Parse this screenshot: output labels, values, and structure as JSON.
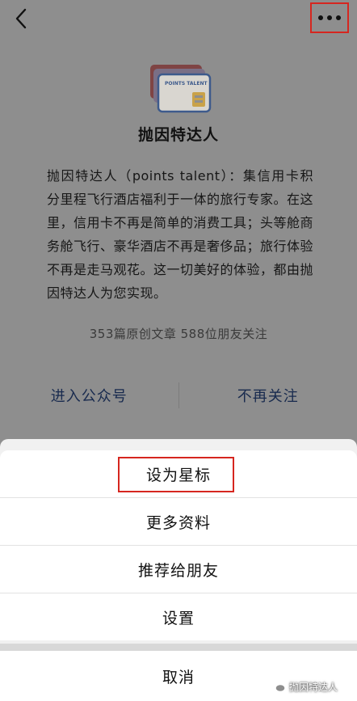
{
  "navbar": {
    "back_icon": "chevron-left-icon",
    "more_icon": "more-dots-icon"
  },
  "account": {
    "logo_text": "POINTS TALENT",
    "name": "抛因特达人",
    "description": "抛因特达人（points talent）：集信用卡积分里程飞行酒店福利于一体的旅行专家。在这里，信用卡不再是简单的消费工具；头等舱商务舱飞行、豪华酒店不再是奢侈品；旅行体验不再是走马观花。这一切美好的体验，都由抛因特达人为您实现。",
    "stats": "353篇原创文章  588位朋友关注"
  },
  "actions": {
    "enter_label": "进入公众号",
    "unfollow_label": "不再关注"
  },
  "action_sheet": {
    "items": [
      {
        "label": "设为星标",
        "highlighted": true
      },
      {
        "label": "更多资料"
      },
      {
        "label": "推荐给朋友"
      },
      {
        "label": "设置"
      }
    ],
    "cancel_label": "取消"
  },
  "watermark": {
    "text": "抛因特达人",
    "icon": "wechat-icon"
  },
  "colors": {
    "highlight": "#d6261f",
    "link": "#182a4e",
    "overlay": "#8e8e8e"
  }
}
